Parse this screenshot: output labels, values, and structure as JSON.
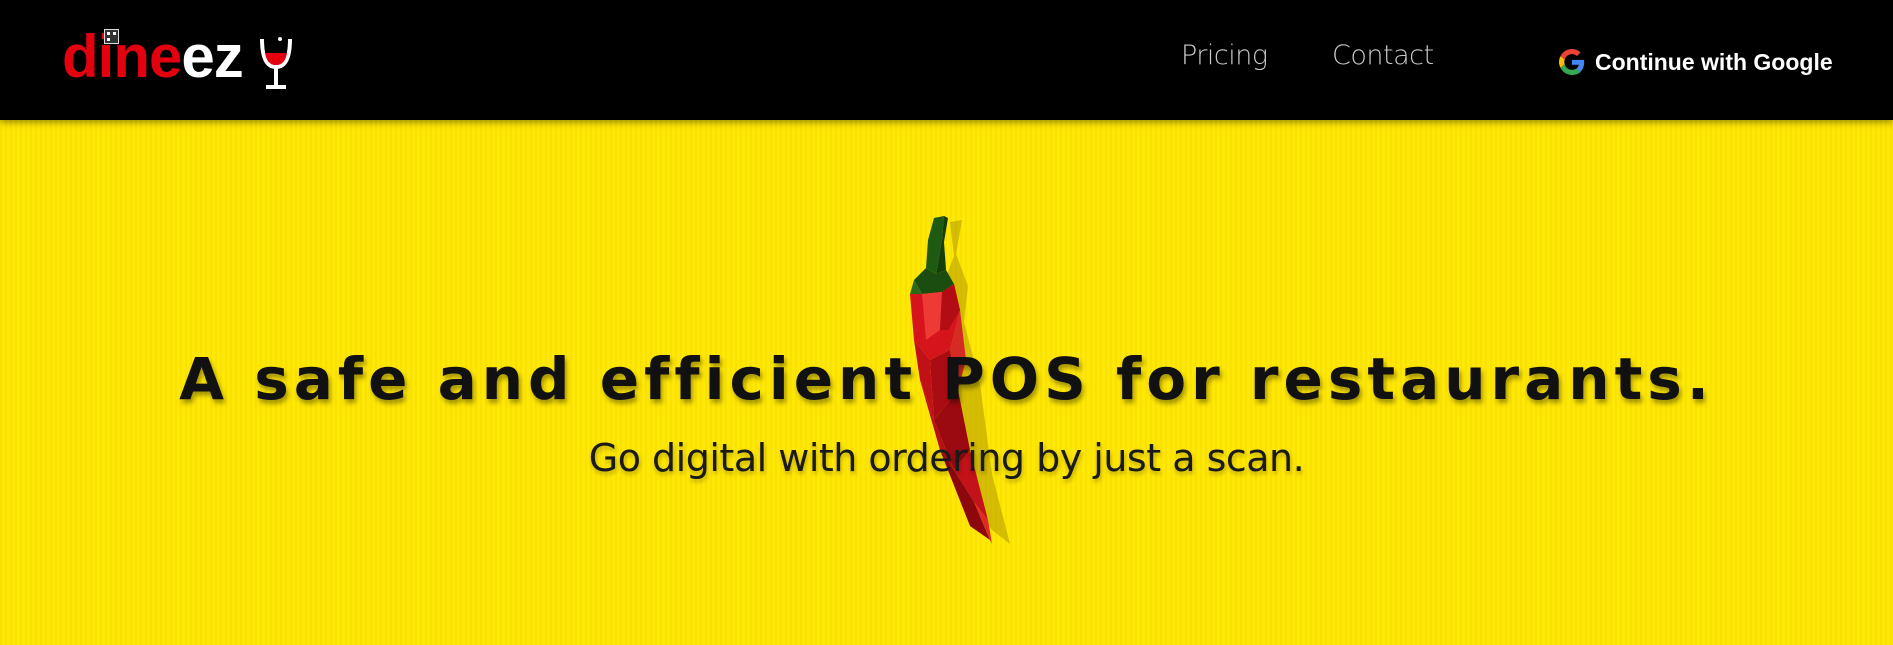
{
  "brand": {
    "logo_part1": "dine",
    "logo_part2": "ez",
    "colors": {
      "red": "#e3000f",
      "white": "#ffffff"
    }
  },
  "nav": {
    "links": [
      {
        "label": "Pricing"
      },
      {
        "label": "Contact"
      }
    ],
    "google_button": {
      "label": "Continue with Google",
      "icon": "google-icon"
    }
  },
  "hero": {
    "headline": "A safe and efficient POS for restaurants.",
    "subline": "Go digital with ordering by just a scan.",
    "illustration": "chili-pepper",
    "background_color": "#ffe600"
  }
}
